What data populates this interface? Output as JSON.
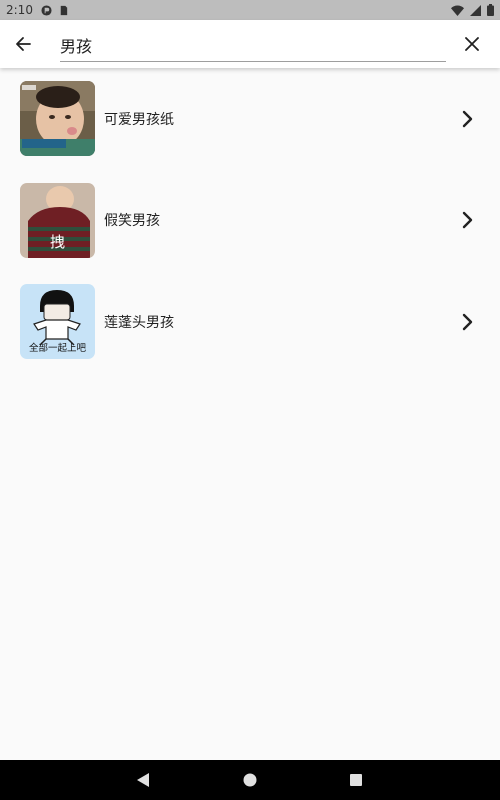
{
  "status_bar": {
    "time": "2:10"
  },
  "search": {
    "query": "男孩"
  },
  "results": [
    {
      "label": "可爱男孩纸",
      "thumb_caption": ""
    },
    {
      "label": "假笑男孩",
      "thumb_caption": "拽"
    },
    {
      "label": "莲蓬头男孩",
      "thumb_caption": "全部一起上吧"
    }
  ],
  "colors": {
    "status_bar_bg": "#bdbdbd",
    "toolbar_bg": "#ffffff",
    "content_bg": "#fafafa",
    "nav_bar_bg": "#000000"
  }
}
